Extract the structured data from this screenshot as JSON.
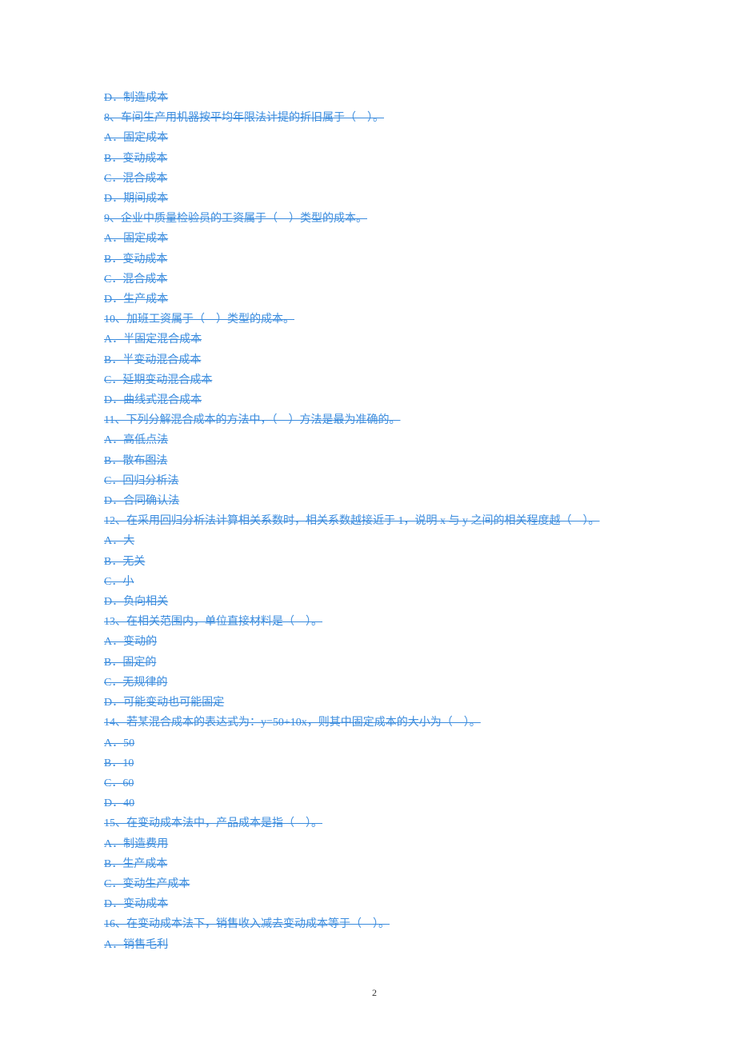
{
  "doc": {
    "lines": [
      "D．制造成本",
      "8、车间生产用机器按平均年限法计提的折旧属于（　）。",
      "A．固定成本",
      "B．变动成本",
      "C．混合成本",
      "D．期间成本",
      "9、企业中质量检验员的工资属于（　）类型的成本。",
      "A．固定成本",
      "B．变动成本",
      "C．混合成本",
      "D．生产成本",
      "10、加班工资属于（　）类型的成本。",
      "A．半固定混合成本",
      "B．半变动混合成本",
      "C．延期变动混合成本",
      "D．曲线式混合成本",
      "11、下列分解混合成本的方法中，（　）方法是最为准确的。",
      "A．高低点法",
      "B．散布图法",
      "C．回归分析法",
      "D．合同确认法",
      "12、在采用回归分析法计算相关系数时，相关系数越接近于 1，说明 x 与 y 之间的相关程度越（　）。",
      "A．大",
      "B．无关",
      "C．小",
      "D．负向相关",
      "13、在相关范围内，单位直接材料是（　）。",
      "A．变动的",
      "B．固定的",
      "C．无规律的",
      "D．可能变动也可能固定",
      "14、若某混合成本的表达式为：y=50+10x，则其中固定成本的大小为（　）。",
      "A．50",
      "B．10",
      "C．60",
      "D．40",
      "15、在变动成本法中，产品成本是指（　）。",
      "A．制造费用",
      "B．生产成本",
      "C．变动生产成本",
      "D．变动成本",
      "16、在变动成本法下，销售收入减去变动成本等于（　）。",
      "A．销售毛利"
    ],
    "page_number": "2"
  }
}
